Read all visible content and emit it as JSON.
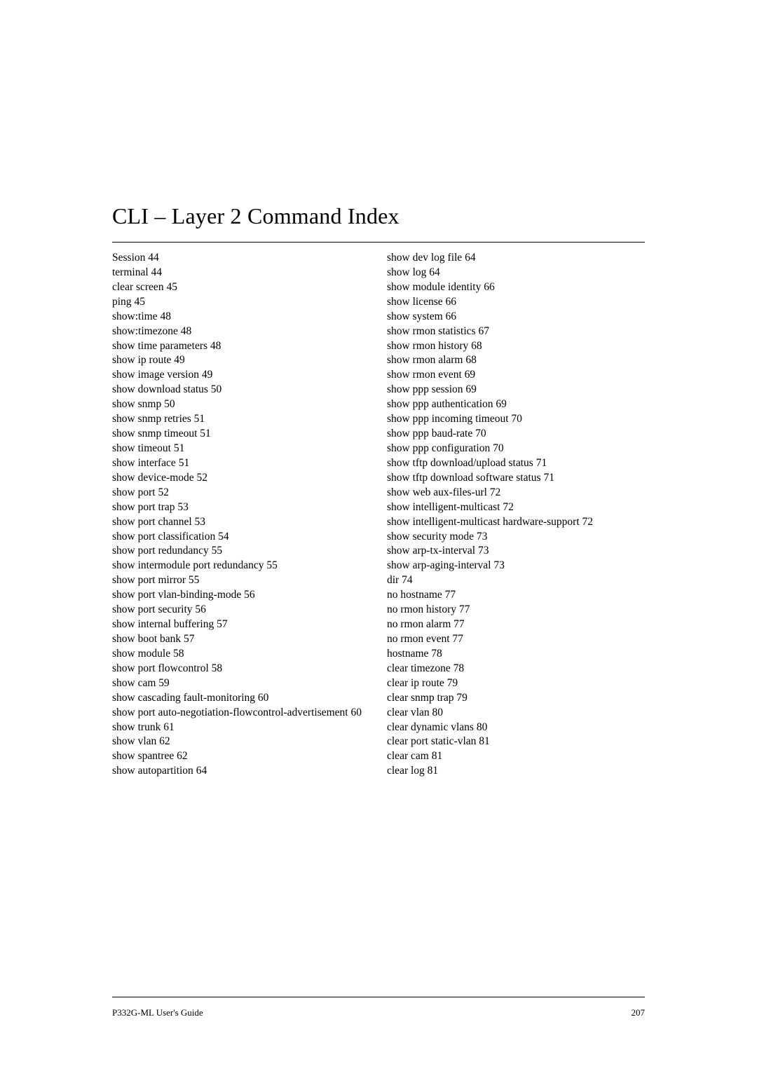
{
  "title": "CLI – Layer 2 Command Index",
  "left_column": [
    {
      "label": "Session",
      "page": "44"
    },
    {
      "label": "terminal",
      "page": "44"
    },
    {
      "label": "clear screen",
      "page": "45"
    },
    {
      "label": "ping",
      "page": "45"
    },
    {
      "label": "show:time",
      "page": "48"
    },
    {
      "label": "show:timezone",
      "page": "48"
    },
    {
      "label": "show time parameters",
      "page": "48"
    },
    {
      "label": "show ip route",
      "page": "49"
    },
    {
      "label": "show image version",
      "page": "49"
    },
    {
      "label": "show download status",
      "page": "50"
    },
    {
      "label": "show snmp",
      "page": "50"
    },
    {
      "label": "show snmp retries",
      "page": "51"
    },
    {
      "label": "show snmp timeout",
      "page": "51"
    },
    {
      "label": "show timeout",
      "page": "51"
    },
    {
      "label": "show interface",
      "page": "51"
    },
    {
      "label": "show device-mode",
      "page": "52"
    },
    {
      "label": "show port",
      "page": "52"
    },
    {
      "label": "show port trap",
      "page": "53"
    },
    {
      "label": "show port channel",
      "page": "53"
    },
    {
      "label": "show port classification",
      "page": "54"
    },
    {
      "label": "show port redundancy",
      "page": "55"
    },
    {
      "label": "show intermodule port redundancy",
      "page": "55"
    },
    {
      "label": "show port mirror",
      "page": "55"
    },
    {
      "label": "show port vlan-binding-mode",
      "page": "56"
    },
    {
      "label": "show port security",
      "page": "56"
    },
    {
      "label": "show internal buffering",
      "page": "57"
    },
    {
      "label": "show boot bank",
      "page": "57"
    },
    {
      "label": "show module",
      "page": "58"
    },
    {
      "label": "show port flowcontrol",
      "page": "58"
    },
    {
      "label": "show cam",
      "page": "59"
    },
    {
      "label": "show cascading fault-monitoring",
      "page": "60"
    },
    {
      "label": "show port auto-negotiation-flowcontrol-advertisement",
      "page": "60"
    },
    {
      "label": "show trunk",
      "page": "61"
    },
    {
      "label": "show vlan",
      "page": "62"
    },
    {
      "label": "show spantree",
      "page": "62"
    },
    {
      "label": "show autopartition",
      "page": "64"
    }
  ],
  "right_column": [
    {
      "label": "show dev log file",
      "page": "64"
    },
    {
      "label": "show log",
      "page": "64"
    },
    {
      "label": "show module identity",
      "page": "66"
    },
    {
      "label": "show license",
      "page": "66"
    },
    {
      "label": "show system",
      "page": "66"
    },
    {
      "label": "show rmon statistics",
      "page": "67"
    },
    {
      "label": "show rmon history",
      "page": "68"
    },
    {
      "label": "show rmon alarm",
      "page": "68"
    },
    {
      "label": "show rmon event",
      "page": "69"
    },
    {
      "label": "show ppp session",
      "page": "69"
    },
    {
      "label": "show ppp authentication",
      "page": "69"
    },
    {
      "label": "show ppp incoming timeout",
      "page": "70"
    },
    {
      "label": "show ppp baud-rate",
      "page": "70"
    },
    {
      "label": "show ppp configuration",
      "page": "70"
    },
    {
      "label": "show tftp download/upload status",
      "page": "71"
    },
    {
      "label": "show tftp download software status",
      "page": "71"
    },
    {
      "label": "show web aux-files-url",
      "page": "72"
    },
    {
      "label": "show intelligent-multicast",
      "page": "72"
    },
    {
      "label": "show intelligent-multicast hardware-support",
      "page": "72"
    },
    {
      "label": "show security mode",
      "page": "73"
    },
    {
      "label": "show arp-tx-interval",
      "page": "73"
    },
    {
      "label": "show arp-aging-interval",
      "page": "73"
    },
    {
      "label": "dir",
      "page": "74"
    },
    {
      "label": "no hostname",
      "page": "77"
    },
    {
      "label": "no rmon history",
      "page": "77"
    },
    {
      "label": "no rmon alarm",
      "page": "77"
    },
    {
      "label": "no rmon event",
      "page": "77"
    },
    {
      "label": "hostname",
      "page": "78"
    },
    {
      "label": "clear timezone",
      "page": "78"
    },
    {
      "label": "clear ip route",
      "page": "79"
    },
    {
      "label": "clear snmp trap",
      "page": "79"
    },
    {
      "label": "clear vlan",
      "page": "80"
    },
    {
      "label": "clear dynamic vlans",
      "page": "80"
    },
    {
      "label": "clear port static-vlan",
      "page": "81"
    },
    {
      "label": "clear cam",
      "page": "81"
    },
    {
      "label": "clear log",
      "page": "81"
    }
  ],
  "footer": {
    "left": "P332G-ML User's Guide",
    "right": "207"
  }
}
